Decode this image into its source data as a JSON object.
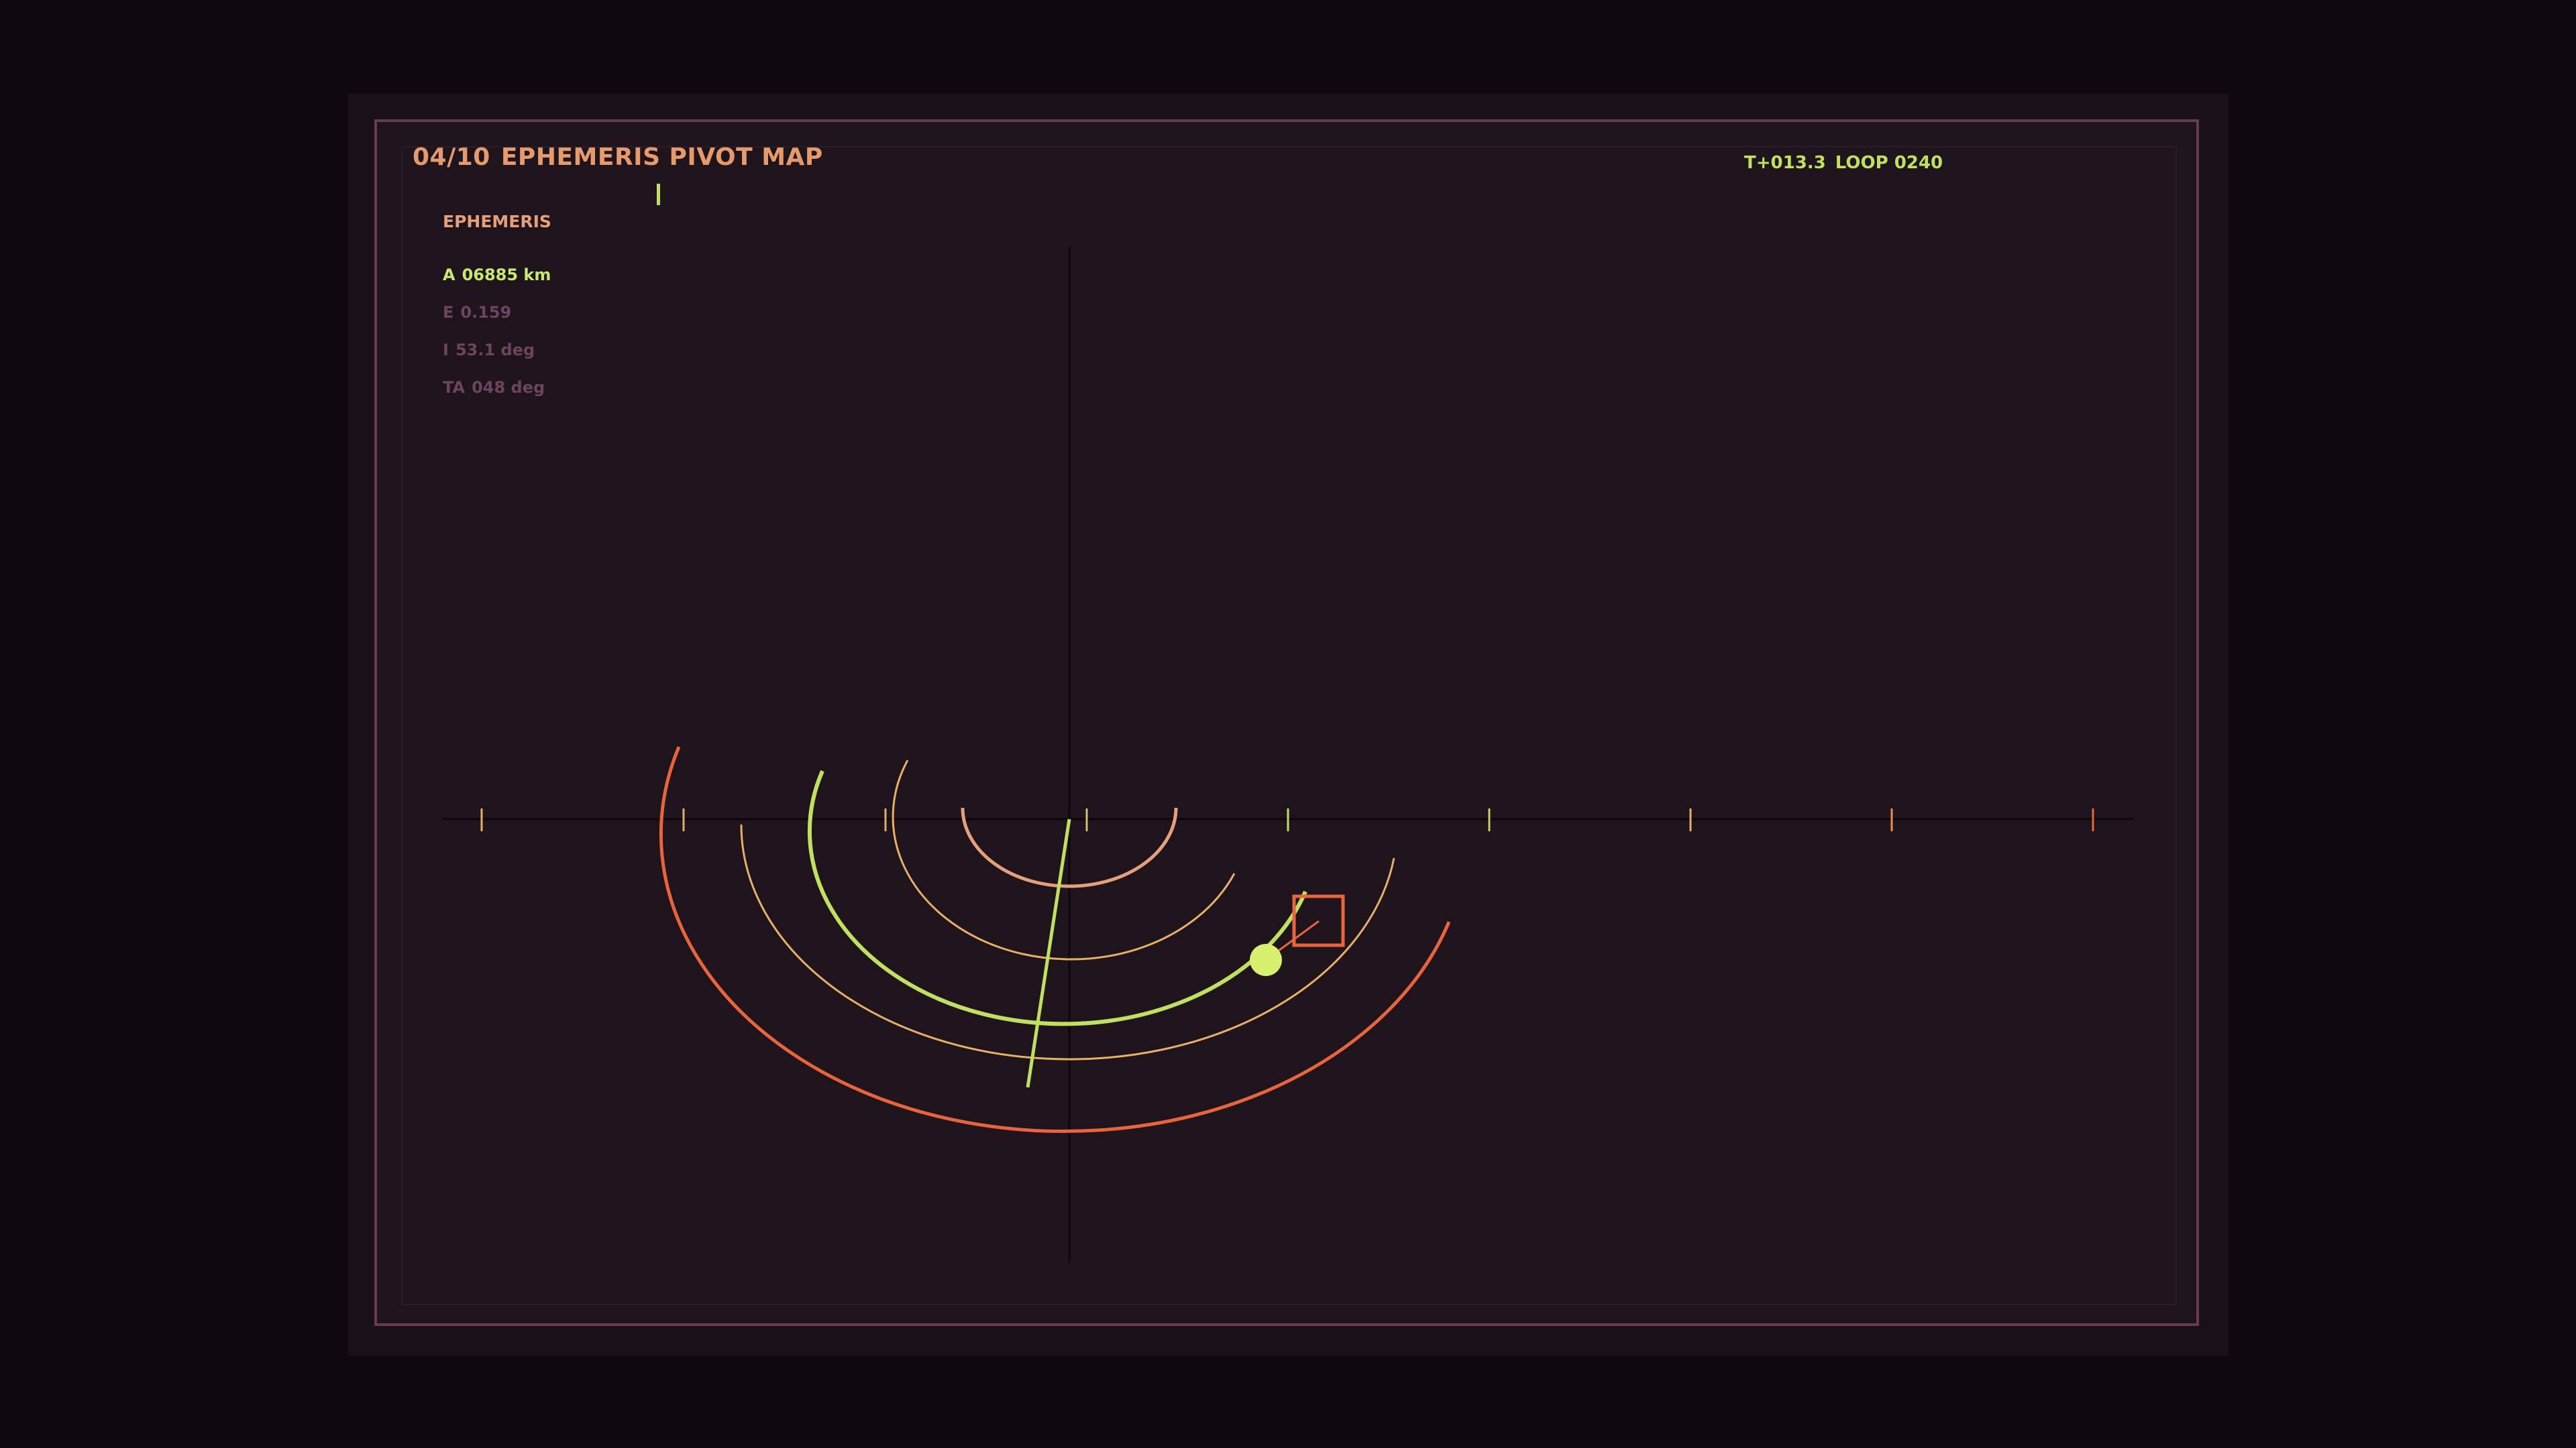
{
  "header": {
    "index": "04/10",
    "title": "EPHEMERIS PIVOT MAP",
    "status_time": "T+013.3",
    "status_loop": "LOOP 0240"
  },
  "ephemeris": {
    "label": "EPHEMERIS",
    "params": [
      {
        "key": "A",
        "value": "06885 km",
        "active": true
      },
      {
        "key": "E",
        "value": "0.159",
        "active": false
      },
      {
        "key": "I",
        "value": "53.1 deg",
        "active": false
      },
      {
        "key": "TA",
        "value": "048 deg",
        "active": false
      }
    ]
  },
  "colors": {
    "background": "#0f080e",
    "frame": "#6a3a52",
    "accent_green": "#c0e060",
    "accent_orange": "#e8643c",
    "accent_tan": "#e4a07a",
    "accent_gold": "#e6b066"
  },
  "orbits": [
    {
      "ring": 1,
      "color": "#e4a07a"
    },
    {
      "ring": 2,
      "color": "#e6b066"
    },
    {
      "ring": 3,
      "color": "#c0e060"
    },
    {
      "ring": 4,
      "color": "#e6b066"
    },
    {
      "ring": 5,
      "color": "#e8643c"
    }
  ],
  "selected_orbit": 3,
  "axis_ticks": 9
}
